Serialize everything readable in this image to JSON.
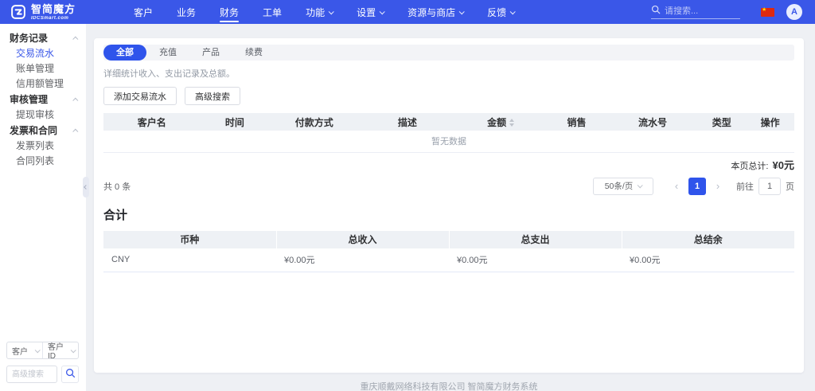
{
  "navbar": {
    "brand": {
      "name": "智简魔方",
      "domain": "IDCSmart.com"
    },
    "items": [
      {
        "label": "客户",
        "active": false,
        "dropdown": false
      },
      {
        "label": "业务",
        "active": false,
        "dropdown": false
      },
      {
        "label": "财务",
        "active": true,
        "dropdown": false
      },
      {
        "label": "工单",
        "active": false,
        "dropdown": false
      },
      {
        "label": "功能",
        "active": false,
        "dropdown": true
      },
      {
        "label": "设置",
        "active": false,
        "dropdown": true
      },
      {
        "label": "资源与商店",
        "active": false,
        "dropdown": true
      },
      {
        "label": "反馈",
        "active": false,
        "dropdown": true
      }
    ],
    "search": {
      "placeholder": "请搜索..."
    },
    "avatar": {
      "letter": "A"
    }
  },
  "sidebar": {
    "groups": [
      {
        "label": "财务记录",
        "items": [
          {
            "label": "交易流水",
            "active": true
          },
          {
            "label": "账单管理",
            "active": false
          },
          {
            "label": "信用额管理",
            "active": false
          }
        ]
      },
      {
        "label": "审核管理",
        "items": [
          {
            "label": "提现审核",
            "active": false
          }
        ]
      },
      {
        "label": "发票和合同",
        "items": [
          {
            "label": "发票列表",
            "active": false
          },
          {
            "label": "合同列表",
            "active": false
          }
        ]
      }
    ],
    "filter": {
      "type_select": "客户",
      "field_select": "客户ID",
      "search_placeholder": "高级搜索"
    }
  },
  "main": {
    "tabs": [
      {
        "label": "全部",
        "active": true
      },
      {
        "label": "充值",
        "active": false
      },
      {
        "label": "产品",
        "active": false
      },
      {
        "label": "续费",
        "active": false
      }
    ],
    "description": "详细统计收入、支出记录及总额。",
    "add_button": "添加交易流水",
    "advanced_search_button": "高级搜索",
    "table": {
      "columns": [
        {
          "label": "客户名",
          "sortable": false
        },
        {
          "label": "时间",
          "sortable": false
        },
        {
          "label": "付款方式",
          "sortable": false
        },
        {
          "label": "描述",
          "sortable": false
        },
        {
          "label": "金额",
          "sortable": true
        },
        {
          "label": "销售",
          "sortable": false
        },
        {
          "label": "流水号",
          "sortable": false
        },
        {
          "label": "类型",
          "sortable": false
        },
        {
          "label": "操作",
          "sortable": false
        }
      ],
      "empty_text": "暂无数据"
    },
    "page_total": {
      "label": "本页总计:",
      "value": "¥0元"
    },
    "pagination": {
      "total_text": "共 0 条",
      "page_size": "50条/页",
      "current_page": "1",
      "goto_label": "前往",
      "goto_value": "1",
      "goto_unit": "页"
    },
    "summary": {
      "title": "合计",
      "columns": [
        "币种",
        "总收入",
        "总支出",
        "总结余"
      ],
      "rows": [
        [
          "CNY",
          "¥0.00元",
          "¥0.00元",
          "¥0.00元"
        ]
      ]
    }
  },
  "footer": {
    "text": "重庆顺戴网络科技有限公司 智简魔方财务系统"
  },
  "icons": {
    "prev": "‹",
    "next": "›"
  },
  "colors": {
    "navbar": "#3a57e8",
    "accent": "#2f54eb",
    "page_bg": "#eef0f4",
    "active_text": "#3a57e8"
  }
}
